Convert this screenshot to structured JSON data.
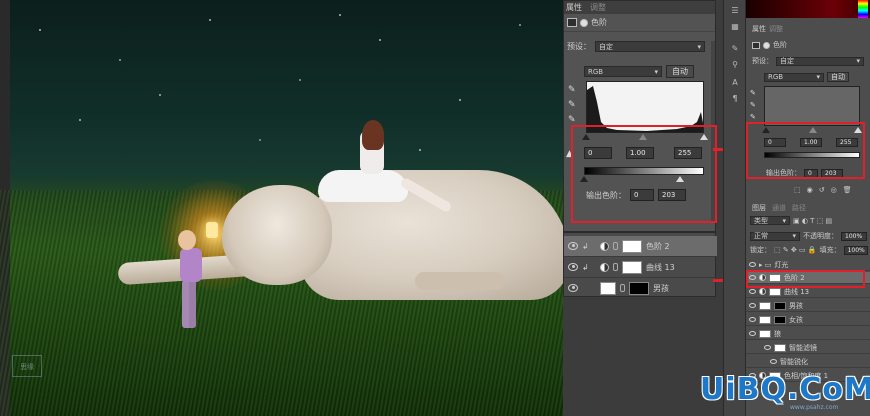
{
  "canvas": {
    "watermark_small": "思缘"
  },
  "properties_panel": {
    "tabs": [
      "属性",
      "调整"
    ],
    "title": "色阶",
    "preset_label": "预设：",
    "preset_value": "自定",
    "channel_value": "RGB",
    "auto_button": "自动",
    "input_black": "0",
    "input_gamma": "1.00",
    "input_white": "255",
    "output_label": "输出色阶：",
    "output_black": "0",
    "output_white": "203"
  },
  "layers_mid": {
    "rows": [
      {
        "name": "色阶 2",
        "selected": true
      },
      {
        "name": "曲线 13",
        "selected": false
      },
      {
        "name": "男孩",
        "selected": false
      }
    ]
  },
  "right_dock": {
    "tabs": [
      "属性",
      "调整"
    ],
    "title": "色阶",
    "preset_label": "预设：",
    "preset_value": "自定",
    "channel_value": "RGB",
    "auto_button": "自动",
    "input_black": "0",
    "input_gamma": "1.00",
    "input_white": "255",
    "output_label": "输出色阶：",
    "output_black": "0",
    "output_white": "203",
    "layers_tabs": [
      "图层",
      "通道",
      "路径"
    ],
    "kind_value": "类型",
    "blend_value": "正常",
    "opacity_label": "不透明度：",
    "opacity_value": "100%",
    "lock_label": "锁定：",
    "fill_label": "填充：",
    "fill_value": "100%",
    "layers": [
      {
        "name": "灯光",
        "thumb": "none",
        "selected": false
      },
      {
        "name": "色阶 2",
        "thumb": "white",
        "selected": true
      },
      {
        "name": "曲线 13",
        "thumb": "white",
        "selected": false
      },
      {
        "name": "男孩",
        "thumb": "black",
        "selected": false
      },
      {
        "name": "女孩",
        "thumb": "black",
        "selected": false
      },
      {
        "name": "狼",
        "thumb": "white",
        "selected": false
      },
      {
        "name": "智能滤镜",
        "thumb": "white",
        "selected": false
      },
      {
        "name": "智能锐化",
        "thumb": "none",
        "selected": false
      },
      {
        "name": "色相/饱和度 1",
        "thumb": "white",
        "selected": false
      }
    ]
  },
  "site_watermark": {
    "logo": "UiBQ.CoM",
    "url": "www.psahz.com"
  },
  "colors": {
    "highlight_red": "#e0202a",
    "panel_bg": "#535353",
    "watermark_blue": "#1d78c8"
  }
}
